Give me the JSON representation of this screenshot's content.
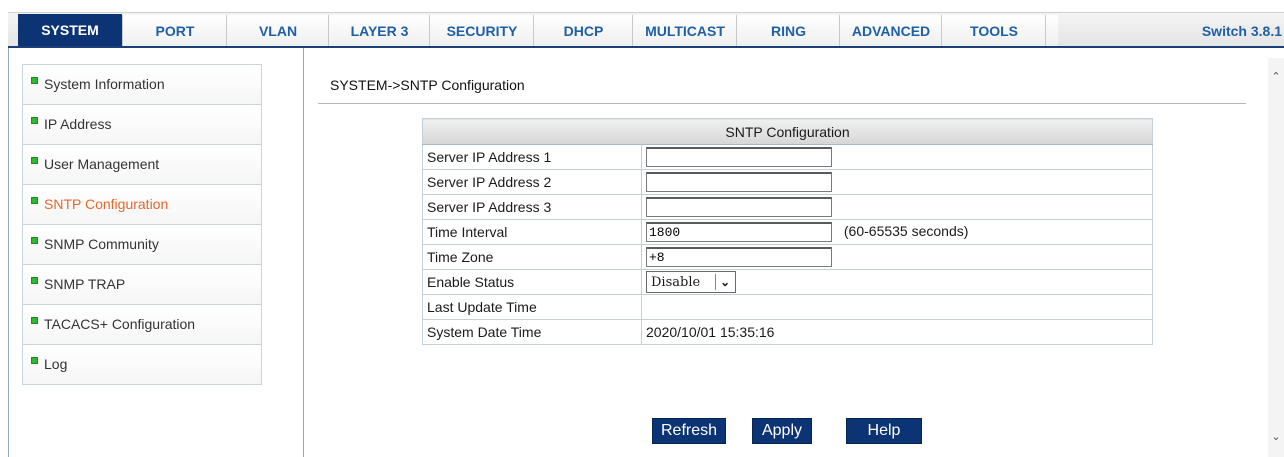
{
  "nav": {
    "tabs": [
      {
        "label": "SYSTEM"
      },
      {
        "label": "PORT"
      },
      {
        "label": "VLAN"
      },
      {
        "label": "LAYER 3"
      },
      {
        "label": "SECURITY"
      },
      {
        "label": "DHCP"
      },
      {
        "label": "MULTICAST"
      },
      {
        "label": "RING"
      },
      {
        "label": "ADVANCED"
      },
      {
        "label": "TOOLS"
      }
    ],
    "active": "SYSTEM",
    "version": "Switch 3.8.1"
  },
  "sidebar": {
    "items": [
      {
        "label": "System Information"
      },
      {
        "label": "IP Address"
      },
      {
        "label": "User Management"
      },
      {
        "label": "SNTP Configuration"
      },
      {
        "label": "SNMP Community"
      },
      {
        "label": "SNMP TRAP"
      },
      {
        "label": "TACACS+ Configuration"
      },
      {
        "label": "Log"
      }
    ],
    "active": "SNTP Configuration"
  },
  "breadcrumb": "SYSTEM->SNTP Configuration",
  "sntp": {
    "title": "SNTP Configuration",
    "server1_label": "Server IP Address 1",
    "server1_value": "",
    "server2_label": "Server IP Address 2",
    "server2_value": "",
    "server3_label": "Server IP Address 3",
    "server3_value": "",
    "interval_label": "Time Interval",
    "interval_value": "1800",
    "interval_unit": "(60-65535 seconds)",
    "timezone_label": "Time Zone",
    "timezone_value": "+8",
    "enable_label": "Enable Status",
    "enable_value": "Disable",
    "last_update_label": "Last Update Time",
    "last_update_value": "",
    "system_time_label": "System Date Time",
    "system_time_value": "2020/10/01 15:35:16"
  },
  "buttons": {
    "refresh": "Refresh",
    "apply": "Apply",
    "help": "Help"
  },
  "colors": {
    "nav_active_bg": "#0c3474",
    "tab_text": "#1f5fa6",
    "menu_active_text": "#e8672a",
    "bullet": "#2eb82e"
  }
}
